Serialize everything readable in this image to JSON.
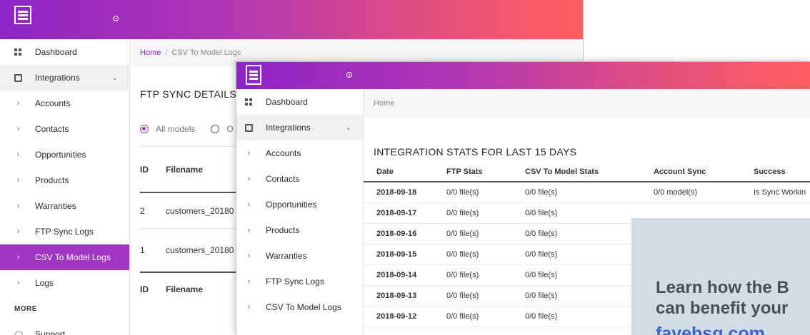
{
  "back_window": {
    "breadcrumb": {
      "home": "Home",
      "separator": "/",
      "current": "CSV To Model Logs"
    },
    "sidebar": {
      "items": [
        {
          "label": "Dashboard",
          "icon": "dashboard-grid-icon"
        },
        {
          "label": "Integrations",
          "icon": "puzzle-icon",
          "expanded": true
        },
        {
          "label": "Accounts"
        },
        {
          "label": "Contacts"
        },
        {
          "label": "Opportunities"
        },
        {
          "label": "Products"
        },
        {
          "label": "Warranties"
        },
        {
          "label": "FTP Sync Logs"
        },
        {
          "label": "CSV To Model Logs",
          "active": true
        },
        {
          "label": "Logs"
        }
      ],
      "more_title": "MORE",
      "support_label": "Support"
    },
    "page_title": "FTP SYNC DETAILS",
    "filter": {
      "all_models": "All models",
      "other_option": "O"
    },
    "table": {
      "headers": [
        "ID",
        "Filename"
      ],
      "rows": [
        {
          "id": "2",
          "filename": "customers_20180"
        },
        {
          "id": "1",
          "filename": "customers_20180"
        }
      ],
      "footer": [
        "ID",
        "Filename"
      ]
    }
  },
  "front_window": {
    "breadcrumb": {
      "home": "Home"
    },
    "sidebar": {
      "items": [
        {
          "label": "Dashboard",
          "icon": "dashboard-grid-icon"
        },
        {
          "label": "Integrations",
          "icon": "puzzle-icon",
          "expanded": true
        },
        {
          "label": "Accounts"
        },
        {
          "label": "Contacts"
        },
        {
          "label": "Opportunities"
        },
        {
          "label": "Products"
        },
        {
          "label": "Warranties"
        },
        {
          "label": "FTP Sync Logs"
        },
        {
          "label": "CSV To Model Logs"
        }
      ]
    },
    "page_title": "INTEGRATION STATS FOR LAST 15 DAYS",
    "stats_table": {
      "headers": [
        "Date",
        "FTP Stats",
        "CSV To Model Stats",
        "Account Sync",
        "Success"
      ],
      "rows": [
        {
          "date": "2018-09-18",
          "ftp": "0/0 file(s)",
          "csv": "0/0 file(s)",
          "account": "0/0 model(s)",
          "success": "Is Sync Workin"
        },
        {
          "date": "2018-09-17",
          "ftp": "0/0 file(s)",
          "csv": "0/0 file(s)",
          "account": "",
          "success": ""
        },
        {
          "date": "2018-09-16",
          "ftp": "0/0 file(s)",
          "csv": "0/0 file(s)",
          "account": "",
          "success": ""
        },
        {
          "date": "2018-09-15",
          "ftp": "0/0 file(s)",
          "csv": "0/0 file(s)",
          "account": "",
          "success": ""
        },
        {
          "date": "2018-09-14",
          "ftp": "0/0 file(s)",
          "csv": "0/0 file(s)",
          "account": "",
          "success": ""
        },
        {
          "date": "2018-09-13",
          "ftp": "0/0 file(s)",
          "csv": "0/0 file(s)",
          "account": "",
          "success": ""
        },
        {
          "date": "2018-09-12",
          "ftp": "0/0 file(s)",
          "csv": "0/0 file(s)",
          "account": "",
          "success": ""
        }
      ]
    }
  },
  "overlay": {
    "line1": "Learn how the B",
    "line2": "can benefit your",
    "link": "favebsg.com"
  },
  "colors": {
    "accent": "#a236c4",
    "header_gradient_start": "#8e24c8",
    "header_gradient_end": "#ff5f5f",
    "overlay_bg": "#cedbe5",
    "overlay_link": "#3c63c8"
  }
}
